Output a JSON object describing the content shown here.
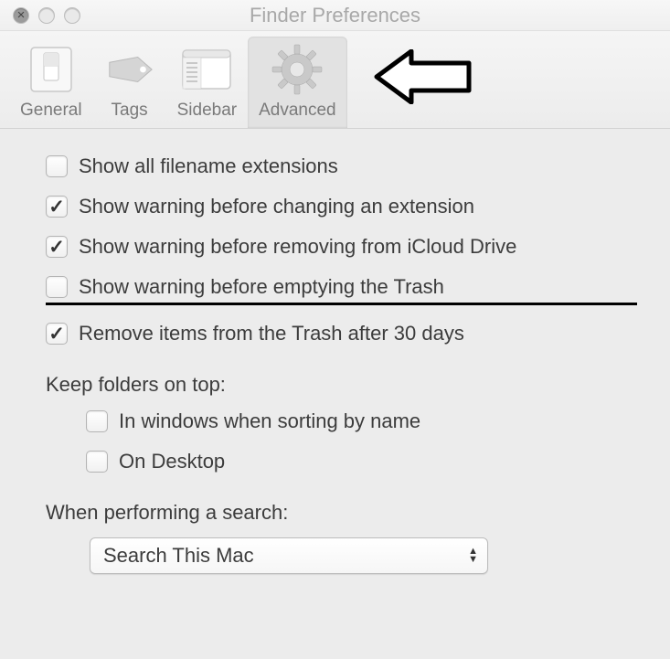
{
  "window": {
    "title": "Finder Preferences"
  },
  "tabs": {
    "general": "General",
    "tags": "Tags",
    "sidebar": "Sidebar",
    "advanced": "Advanced"
  },
  "options": {
    "show_extensions": {
      "label": "Show all filename extensions",
      "checked": false
    },
    "warn_extension": {
      "label": "Show warning before changing an extension",
      "checked": true
    },
    "warn_icloud": {
      "label": "Show warning before removing from iCloud Drive",
      "checked": true
    },
    "warn_trash": {
      "label": "Show warning before emptying the Trash",
      "checked": false
    },
    "remove_30days": {
      "label": "Remove items from the Trash after 30 days",
      "checked": true
    }
  },
  "folders_section": {
    "heading": "Keep folders on top:",
    "in_windows": {
      "label": "In windows when sorting by name",
      "checked": false
    },
    "on_desktop": {
      "label": "On Desktop",
      "checked": false
    }
  },
  "search_section": {
    "heading": "When performing a search:",
    "selected": "Search This Mac"
  }
}
